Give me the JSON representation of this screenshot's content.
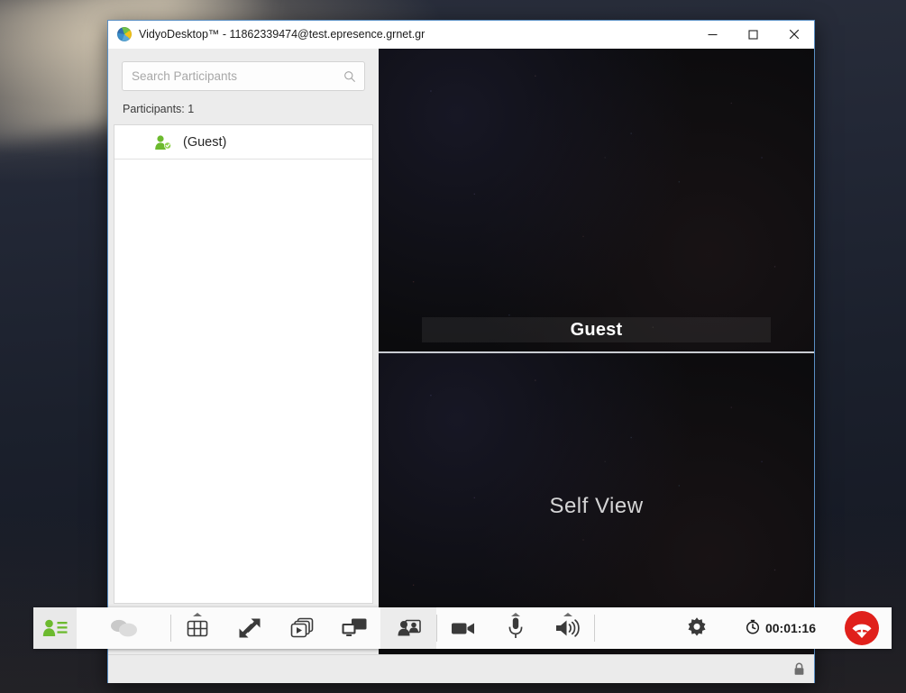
{
  "window": {
    "title": "VidyoDesktop™ - 11862339474@test.epresence.grnet.gr",
    "app_icon": "vidyo-cube-icon",
    "controls": {
      "minimize_label": "Minimize",
      "maximize_label": "Maximize",
      "close_label": "Close"
    }
  },
  "participants_panel": {
    "search": {
      "placeholder": "Search Participants",
      "value": "",
      "icon": "search-icon"
    },
    "count_label": "Participants: 1",
    "list": [
      {
        "name": "(Guest)",
        "icon": "participant-online-icon",
        "status": "online"
      }
    ],
    "keypad_button_label": "",
    "keypad_icon": "keypad-grid-icon"
  },
  "video": {
    "remote": {
      "name": "Guest"
    },
    "selfview": {
      "label": "Self View"
    }
  },
  "status_bar": {
    "lock_icon": "padlock-icon",
    "lock_tooltip": "Encrypted"
  },
  "toolbar": {
    "left_group": [
      {
        "name": "participants",
        "icon": "participants-list-icon",
        "label": "Participants",
        "state": "active"
      },
      {
        "name": "chat",
        "icon": "chat-bubbles-icon",
        "label": "Chat",
        "state": "disabled"
      }
    ],
    "center_group": [
      {
        "name": "layout",
        "icon": "grid-layout-icon",
        "label": "Layout",
        "has_caret": true
      },
      {
        "name": "fullscreen",
        "icon": "resize-arrows-icon",
        "label": "Full Screen",
        "has_caret": false
      },
      {
        "name": "recordings",
        "icon": "video-stack-play-icon",
        "label": "Recordings",
        "has_caret": false
      },
      {
        "name": "share",
        "icon": "screen-share-icon",
        "label": "Share",
        "has_caret": false
      },
      {
        "name": "selfview-toggle",
        "icon": "self-view-icon",
        "label": "Self View",
        "has_caret": false
      }
    ],
    "media_group": [
      {
        "name": "camera",
        "icon": "camera-icon",
        "label": "Camera",
        "has_caret": false
      },
      {
        "name": "microphone",
        "icon": "microphone-icon",
        "label": "Microphone",
        "has_caret": true
      },
      {
        "name": "speaker",
        "icon": "speaker-icon",
        "label": "Speaker",
        "has_caret": true
      }
    ],
    "right_group": {
      "settings": {
        "icon": "gear-icon",
        "label": "Configuration"
      },
      "timer": {
        "icon": "stopwatch-icon",
        "value": "00:01:16"
      },
      "hangup": {
        "icon": "hangup-icon",
        "label": "Disconnect"
      }
    }
  },
  "colors": {
    "accent_green": "#6cba2e",
    "hangup_red": "#e0201b",
    "window_border_blue": "#5a8fc4",
    "panel_gray": "#ececec"
  }
}
